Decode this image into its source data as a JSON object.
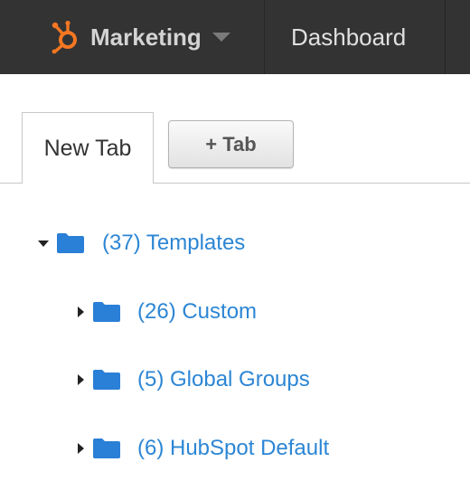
{
  "header": {
    "brand_label": "Marketing",
    "nav_dashboard": "Dashboard",
    "colors": {
      "bar": "#333333",
      "logo": "#f57722"
    }
  },
  "tabs": {
    "new_tab_label": "New Tab",
    "add_tab_label": "+ Tab"
  },
  "tree": {
    "root": {
      "label": "(37) Templates",
      "expanded": true
    },
    "children": [
      {
        "label": "(26) Custom",
        "expanded": false
      },
      {
        "label": "(5) Global Groups",
        "expanded": false
      },
      {
        "label": "(6) HubSpot Default",
        "expanded": false
      }
    ],
    "colors": {
      "folder": "#2a7fd6",
      "link": "#2c86d4"
    }
  }
}
